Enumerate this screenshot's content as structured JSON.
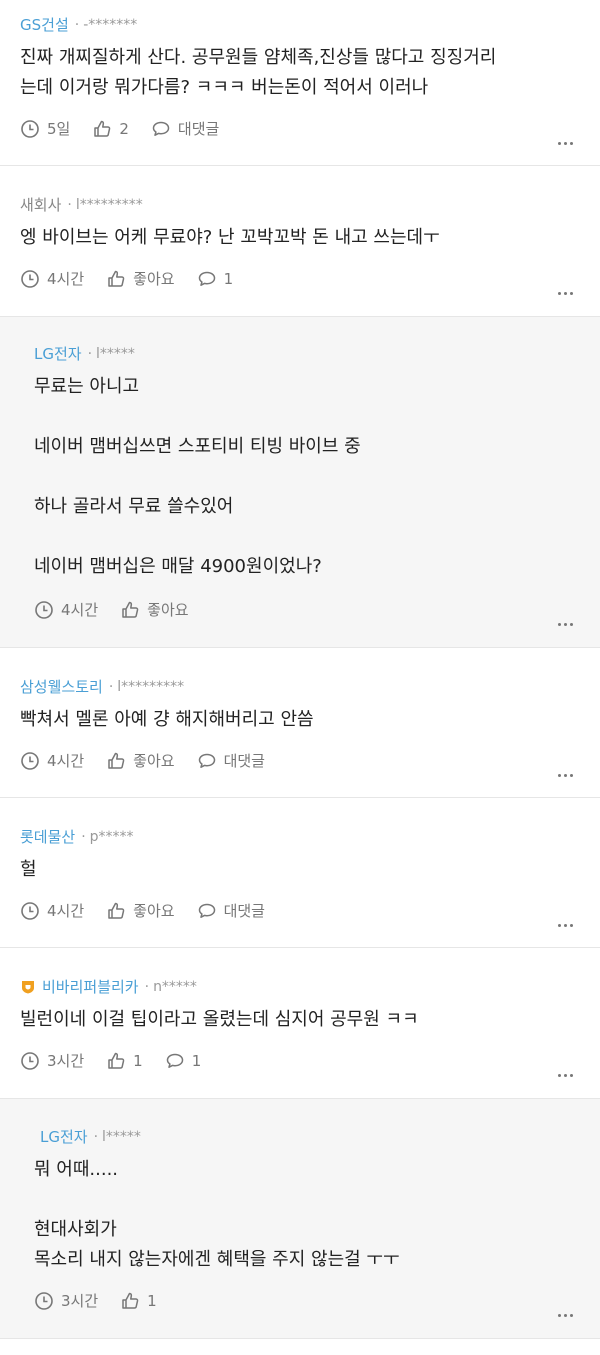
{
  "comments": [
    {
      "company": "GS건설",
      "user": "-*******",
      "text": "진짜 개찌질하게 산다. 공무원들 얌체족,진상들 많다고 징징거리\n는데 이거랑 뭐가다름? ㅋㅋㅋ 버는돈이 적어서 이러나",
      "time": "5일",
      "like": "2",
      "reply": "대댓글"
    },
    {
      "company": "새회사",
      "user": "l*********",
      "text": "엥 바이브는 어케 무료야? 난 꼬박꼬박 돈 내고 쓰는데ㅜ",
      "time": "4시간",
      "like": "좋아요",
      "reply": "1"
    },
    {
      "company": "LG전자",
      "user": "l*****",
      "text": "무료는 아니고\n\n네이버 맴버십쓰면 스포티비 티빙 바이브 중\n\n하나 골라서 무료 쓸수있어\n\n네이버 맴버십은 매달 4900원이었나?",
      "time": "4시간",
      "like": "좋아요"
    },
    {
      "company": "삼성웰스토리",
      "user": "l*********",
      "text": "빡쳐서 멜론 아예 걍 해지해버리고 안씀",
      "time": "4시간",
      "like": "좋아요",
      "reply": "대댓글"
    },
    {
      "company": "롯데물산",
      "user": "p*****",
      "text": "헐",
      "time": "4시간",
      "like": "좋아요",
      "reply": "대댓글"
    },
    {
      "company": "비바리퍼블리카",
      "user": "n*****",
      "text": "빌런이네 이걸 팁이라고 올렸는데 심지어 공무원 ㅋㅋ",
      "time": "3시간",
      "like": "1",
      "reply": "1"
    },
    {
      "company": "LG전자",
      "user": "l*****",
      "text": "뭐 어때.....\n\n현대사회가\n목소리 내지 않는자에겐 혜택을 주지 않는걸 ㅜㅜ",
      "time": "3시간",
      "like": "1"
    }
  ],
  "icons": {
    "time": "clock-icon",
    "like": "thumbs-up-icon",
    "reply": "speech-bubble-icon",
    "more": "more-options-icon",
    "badge": "gold-badge-icon"
  },
  "colors": {
    "company": "#4a9fd5",
    "meta": "#777777",
    "reply_bg": "#f6f6f6",
    "badge": "#f0a020"
  }
}
